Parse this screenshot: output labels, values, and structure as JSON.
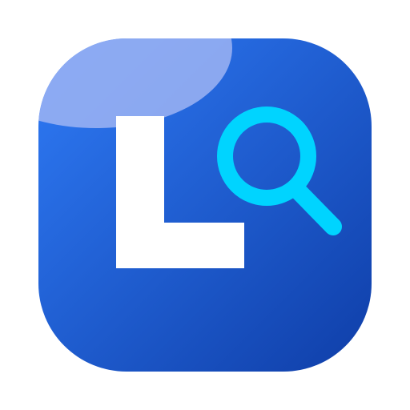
{
  "icon": {
    "name": "app-icon-letter-l-with-magnifier",
    "glyph": "L",
    "symbol": "magnifying-glass-icon"
  },
  "colors": {
    "background_gradient_start": "#2F7BF6",
    "background_gradient_end": "#0F3EA8",
    "highlight": "#9EB4F3",
    "letter": "#FFFFFF",
    "magnifier": "#00D4FF",
    "page_background": "#FFFFFF"
  }
}
